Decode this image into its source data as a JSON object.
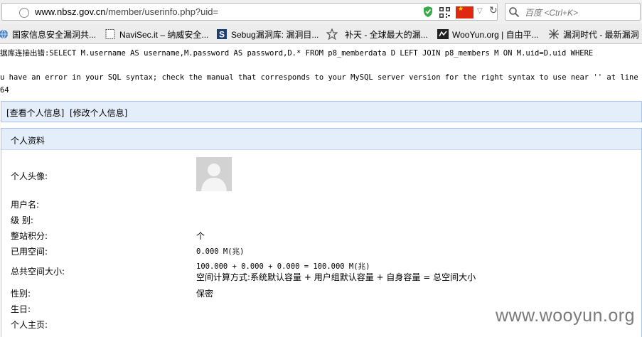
{
  "browser": {
    "url": {
      "host": "www.nbsz.gov.cn",
      "path": "/member/userinfo.php?uid="
    },
    "search_placeholder": "百度 <Ctrl+K>",
    "bookmarks": [
      {
        "label": "国家信息安全漏洞共...",
        "icon": "globe-icon"
      },
      {
        "label": "NaviSec.it – 纳威安全...",
        "icon": "page-icon"
      },
      {
        "label": "Sebug漏洞库: 漏洞目...",
        "icon": "s-logo-icon"
      },
      {
        "label": "补天 - 全球最大的漏...",
        "icon": "star-icon"
      },
      {
        "label": "WooYun.org | 自由平...",
        "icon": "wooyun-icon"
      },
      {
        "label": "漏洞时代 - 最新漏洞",
        "icon": "bug-icon"
      }
    ],
    "flag_color": "#de2910"
  },
  "error": {
    "line1": "据库连接出错:SELECT M.username AS username,M.password AS password,D.* FROM p8_memberdata D LEFT JOIN p8_members M ON M.uid=D.uid WHERE",
    "line2": "u have an error in your SQL syntax; check the manual that corresponds to your MySQL server version for the right syntax to use near '' at line 1",
    "line3": "64"
  },
  "links": {
    "view": "[查看个人信息]",
    "edit": "[修改个人信息]"
  },
  "panel": {
    "title": "个人资料",
    "fields": {
      "avatar_label": "个人头像:",
      "username_label": "用户名:",
      "level_label": "级 别:",
      "points_label": "整站积分:",
      "points_value": "个",
      "used_label": "已用空间:",
      "used_value": "0.000 M(兆)",
      "total_label": "总共空间大小:",
      "total_value": "100.000 + 0.000 + 0.000 = 100.000 M(兆)",
      "total_note": "空间计算方式:系统默认容量 + 用户组默认容量 + 自身容量 = 总空间大小",
      "gender_label": "性别:",
      "gender_value": "保密",
      "birthday_label": "生日:",
      "homepage_label": "个人主页:"
    }
  },
  "watermark": "www.wooyun.org",
  "colors": {
    "panel_header_bg": "#e4eefb",
    "panel_border": "#a9c4e6"
  }
}
